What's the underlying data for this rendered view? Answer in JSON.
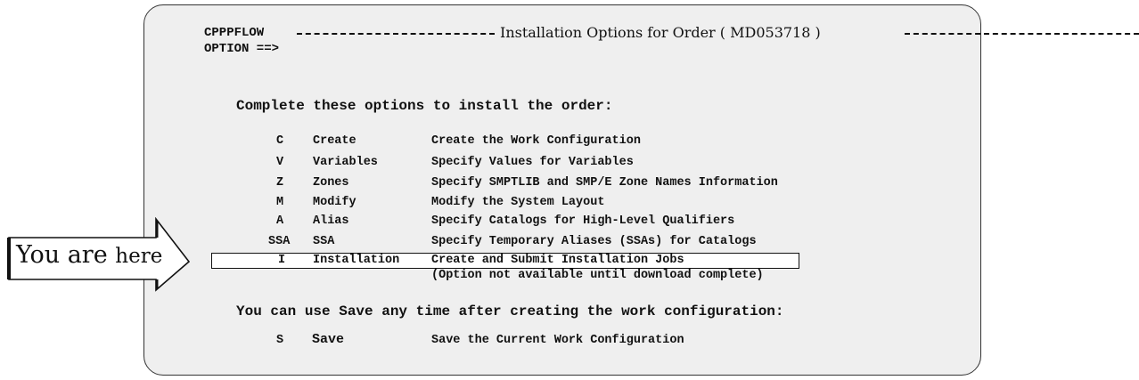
{
  "screen": {
    "panel_id": "CPPPFLOW",
    "title": "Installation Options for Order ( MD053718 )",
    "option_prompt": "OPTION ==>",
    "option_value": ""
  },
  "sections": {
    "complete_intro": "Complete these options to install the order:",
    "save_intro": "You can use Save any time after creating the work configuration:"
  },
  "options": [
    {
      "code": "C",
      "name": "Create",
      "description": "Create the Work Configuration"
    },
    {
      "code": "V",
      "name": "Variables",
      "description": "Specify Values for Variables"
    },
    {
      "code": "Z",
      "name": "Zones",
      "description": "Specify SMPTLIB and SMP/E Zone Names Information"
    },
    {
      "code": "M",
      "name": "Modify",
      "description": "Modify the System Layout"
    },
    {
      "code": "A",
      "name": "Alias",
      "description": "Specify Catalogs for High-Level Qualifiers"
    },
    {
      "code": "SSA",
      "name": "SSA",
      "description": "Specify Temporary Aliases (SSAs) for Catalogs"
    },
    {
      "code": "I",
      "name": "Installation",
      "description": "Create and Submit Installation Jobs",
      "note": "(Option not available until download complete)"
    }
  ],
  "save_option": {
    "code": "S",
    "name": "Save",
    "description": "Save the Current Work Configuration"
  },
  "callout": {
    "part1": "You are",
    "part2": "here"
  },
  "icons": {
    "callout_arrow": "right-arrow-callout-icon"
  },
  "colors": {
    "panel_background": "#efefef",
    "border": "#333333",
    "text": "#111111",
    "highlight_background": "#ffffff"
  }
}
